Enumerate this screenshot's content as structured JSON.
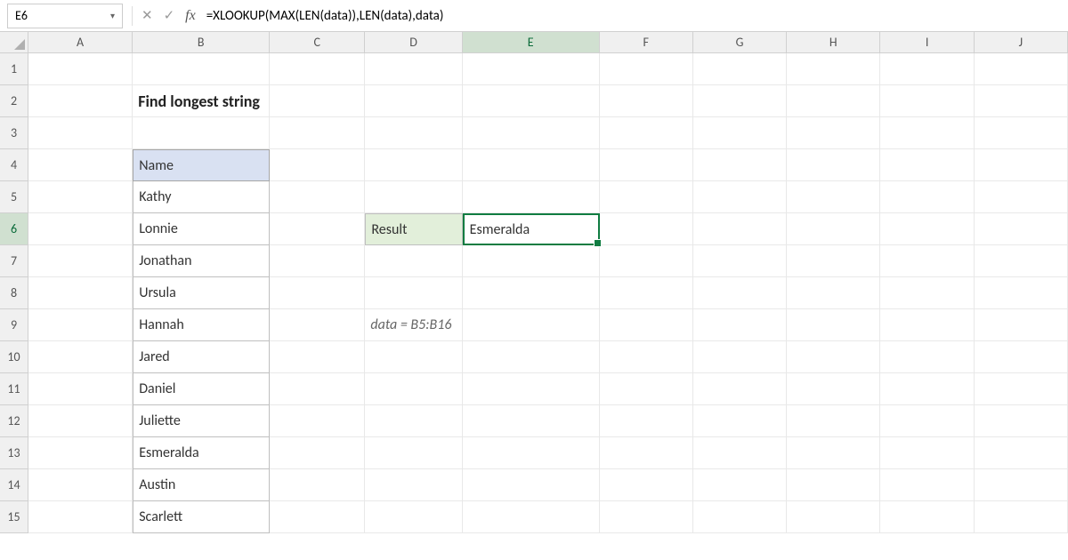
{
  "nameBox": "E6",
  "formula": "=XLOOKUP(MAX(LEN(data)),LEN(data),data)",
  "columns": [
    "A",
    "B",
    "C",
    "D",
    "E",
    "F",
    "G",
    "H",
    "I",
    "J"
  ],
  "rows": [
    "1",
    "2",
    "3",
    "4",
    "5",
    "6",
    "7",
    "8",
    "9",
    "10",
    "11",
    "12",
    "13",
    "14",
    "15"
  ],
  "activeCol": "E",
  "activeRow": "6",
  "title": "Find longest string",
  "tableHeader": "Name",
  "names": [
    "Kathy",
    "Lonnie",
    "Jonathan",
    "Ursula",
    "Hannah",
    "Jared",
    "Daniel",
    "Juliette",
    "Esmeralda",
    "Austin",
    "Scarlett"
  ],
  "resultLabel": "Result",
  "resultValue": "Esmeralda",
  "note": "data = B5:B16"
}
